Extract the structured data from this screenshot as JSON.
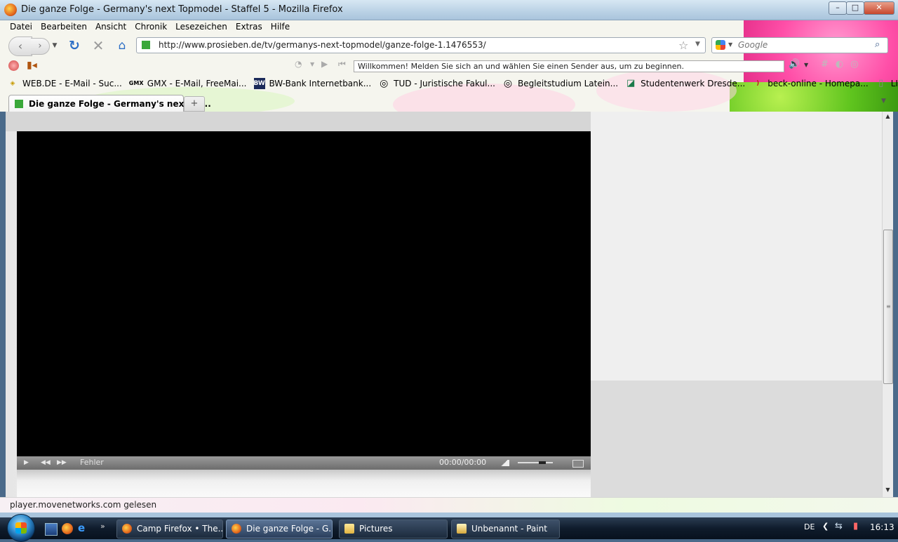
{
  "window": {
    "title": "Die ganze Folge - Germany's next Topmodel - Staffel 5 - Mozilla Firefox",
    "min_label": "–",
    "max_label": "□",
    "close_label": "✕"
  },
  "menubar": {
    "items": [
      "Datei",
      "Bearbeiten",
      "Ansicht",
      "Chronik",
      "Lesezeichen",
      "Extras",
      "Hilfe"
    ]
  },
  "navbar": {
    "back": "‹",
    "forward": "›",
    "reload": "↻",
    "stop": "✕",
    "home": "⌂",
    "url": "http://www.prosieben.de/tv/germanys-next-topmodel/ganze-folge-1.1476553/",
    "search_placeholder": "Google"
  },
  "toolbar2": {
    "welcome_text": "Willkommen! Melden Sie sich an und wählen Sie einen Sender aus, um zu beginnen."
  },
  "bookmarks": [
    {
      "icon": "webde-icon",
      "icon_text": "◈",
      "label": "WEB.DE - E-Mail - Suc..."
    },
    {
      "icon": "gmx-icon",
      "icon_text": "GMX",
      "label": "GMX - E-Mail, FreeMai..."
    },
    {
      "icon": "bwbank-icon",
      "icon_text": "BW",
      "label": "BW-Bank Internetbank..."
    },
    {
      "icon": "tud-icon",
      "icon_text": "◎",
      "label": "TUD - Juristische Fakul..."
    },
    {
      "icon": "tud-icon",
      "icon_text": "◎",
      "label": "Begleitstudium Latein..."
    },
    {
      "icon": "studentenwerk-icon",
      "icon_text": "◪",
      "label": "Studentenwerk Dresde..."
    },
    {
      "icon": "beck-icon",
      "icon_text": ")",
      "label": "beck-online - Homepa..."
    },
    {
      "icon": "page-icon",
      "icon_text": "▯",
      "label": "LIBERO WebOPAC Einf..."
    }
  ],
  "tabs": {
    "active_label": "Die ganze Folge - Germany's next To...",
    "new_tab": "+"
  },
  "player": {
    "status": "Fehler",
    "time": "00:00/00:00",
    "volume_level": 0.75
  },
  "statusbar": {
    "text": "player.movenetworks.com gelesen"
  },
  "taskbar": {
    "tasks": [
      {
        "label": "Camp Firefox • The..."
      },
      {
        "label": "Die ganze Folge - G..."
      },
      {
        "label": "Pictures"
      },
      {
        "label": "Unbenannt - Paint"
      }
    ],
    "more": "»",
    "lang": "DE",
    "time": "16:13"
  },
  "colors": {
    "accent_green": "#5fc41e",
    "accent_pink": "#ff4fa8",
    "favicon_green": "#3aa83a"
  }
}
